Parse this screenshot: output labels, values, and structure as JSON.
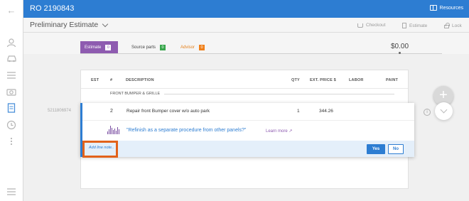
{
  "topbar": {
    "ro_number": "RO 2190843",
    "resources_label": "Resources"
  },
  "header": {
    "title": "Preliminary Estimate",
    "actions": {
      "checkout": "Checkout",
      "estimate": "Estimate",
      "lock": "Lock"
    }
  },
  "tabs": {
    "estimate": {
      "label": "Estimate",
      "count": "0"
    },
    "source_parts": {
      "label": "Source parts",
      "count": "0"
    },
    "advisor": {
      "label": "Advisor",
      "count": "0"
    },
    "total": "$0.00"
  },
  "table": {
    "columns": {
      "est": "EST",
      "num": "#",
      "description": "DESCRIPTION",
      "qty": "QTY",
      "ext_price": "EXT. PRICE $",
      "labor": "LABOR",
      "paint": "PAINT"
    },
    "group": "FRONT BUMPER & GRILLE"
  },
  "row": {
    "id": "5211806974",
    "num": "2",
    "description": "Repair front Bumper cover w/o auto park",
    "qty": "1",
    "price": "344.26",
    "question": "\"Refinish as a separate procedure from other panels?\"",
    "learn_more": "Learn more ↗",
    "add_note": "Add line note..",
    "yes": "Yes",
    "no": "No"
  },
  "icons": {
    "rail": [
      "back-arrow-icon",
      "person-icon",
      "car-icon",
      "list-icon",
      "camera-icon",
      "document-icon",
      "history-icon",
      "more-icon",
      "menu-icon"
    ],
    "fab": "plus-icon",
    "fab2": "chevron-down-icon",
    "info": "info-icon"
  },
  "colors": {
    "primary": "#2d7dd2",
    "estimate_tab": "#8e5bb0",
    "source_badge": "#38a64c",
    "advisor": "#ef7f1a",
    "highlight": "#e2621b"
  }
}
